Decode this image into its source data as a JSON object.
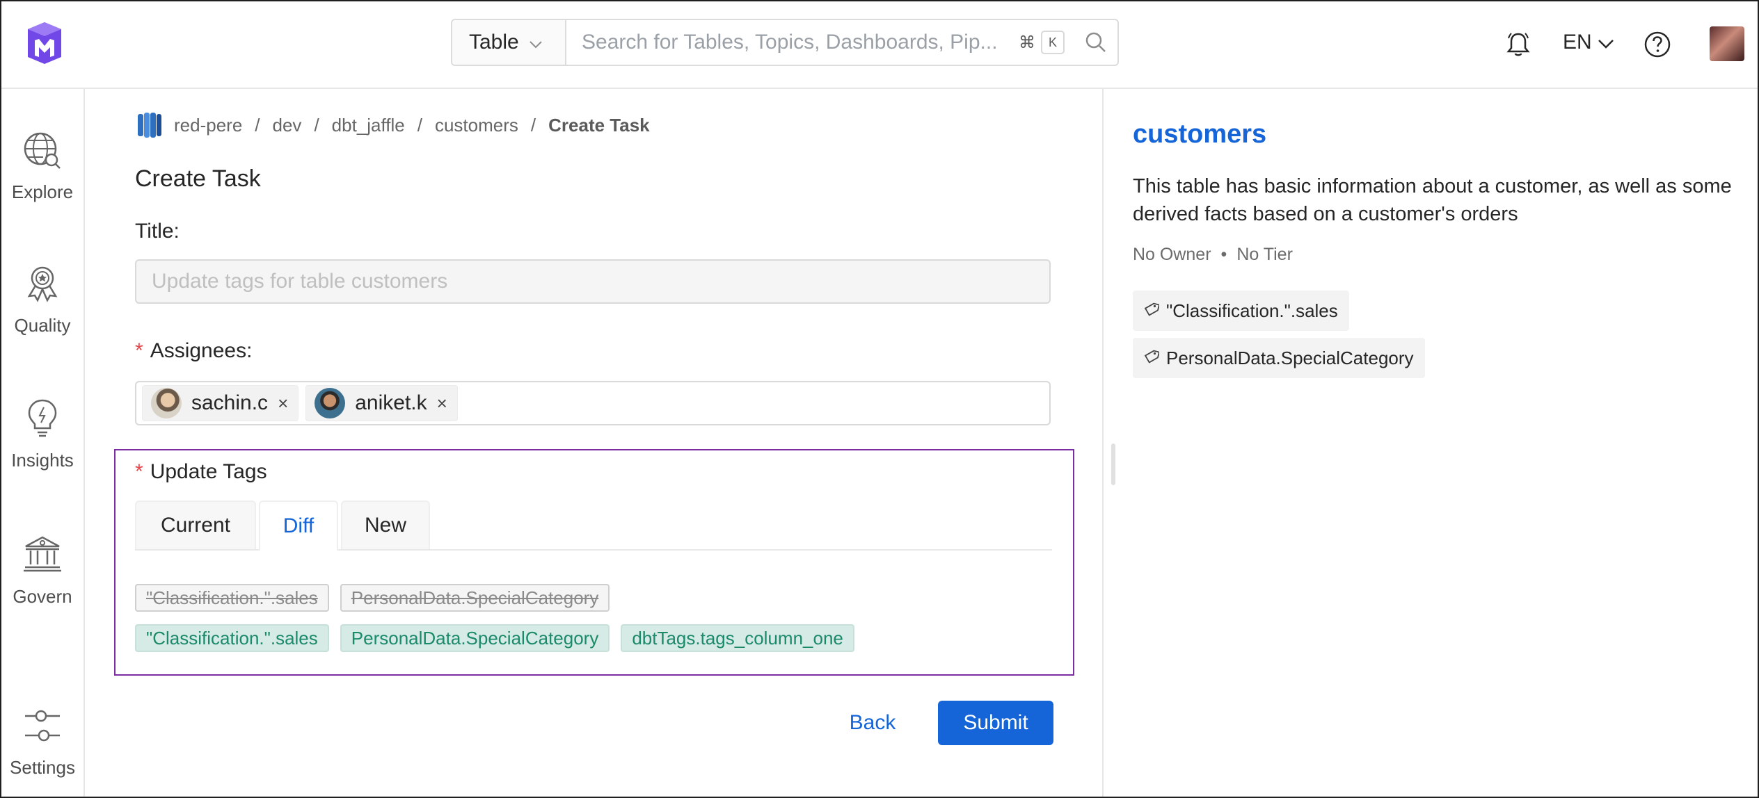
{
  "header": {
    "search_type": "Table",
    "search_placeholder": "Search for Tables, Topics, Dashboards, Pip...",
    "shortcut_cmd": "⌘",
    "shortcut_key": "K",
    "language": "EN"
  },
  "nav": {
    "items": [
      {
        "label": "Explore",
        "icon": "explore-globe-icon"
      },
      {
        "label": "Quality",
        "icon": "quality-badge-icon"
      },
      {
        "label": "Insights",
        "icon": "insights-bulb-icon"
      },
      {
        "label": "Govern",
        "icon": "govern-bank-icon"
      },
      {
        "label": "Settings",
        "icon": "settings-sliders-icon"
      }
    ]
  },
  "breadcrumb": [
    "red-pere",
    "dev",
    "dbt_jaffle",
    "customers",
    "Create Task"
  ],
  "form": {
    "page_title": "Create Task",
    "title_label": "Title:",
    "title_value": "Update tags for table customers",
    "assignees_label": "Assignees:",
    "assignees": [
      {
        "name": "sachin.c",
        "remove": "×"
      },
      {
        "name": "aniket.k",
        "remove": "×"
      }
    ],
    "required_mark": "*",
    "update_tags_label": "Update Tags",
    "tabs": [
      {
        "label": "Current",
        "active": false
      },
      {
        "label": "Diff",
        "active": true
      },
      {
        "label": "New",
        "active": false
      }
    ],
    "removed_tags": [
      "\"Classification.\".sales",
      "PersonalData.SpecialCategory"
    ],
    "added_tags": [
      "\"Classification.\".sales",
      "PersonalData.SpecialCategory",
      "dbtTags.tags_column_one"
    ],
    "back_label": "Back",
    "submit_label": "Submit"
  },
  "entity": {
    "name": "customers",
    "description": "This table has basic information about a customer, as well as some derived facts based on a customer's orders",
    "owner": "No Owner",
    "meta_sep": "•",
    "tier": "No Tier",
    "tags": [
      "\"Classification.\".sales",
      "PersonalData.SpecialCategory"
    ]
  },
  "colors": {
    "accent": "#1565d8",
    "highlight_border": "#7b2ca3",
    "added_tag_text": "#1a8a68",
    "added_tag_bg": "#d6ebe6"
  }
}
